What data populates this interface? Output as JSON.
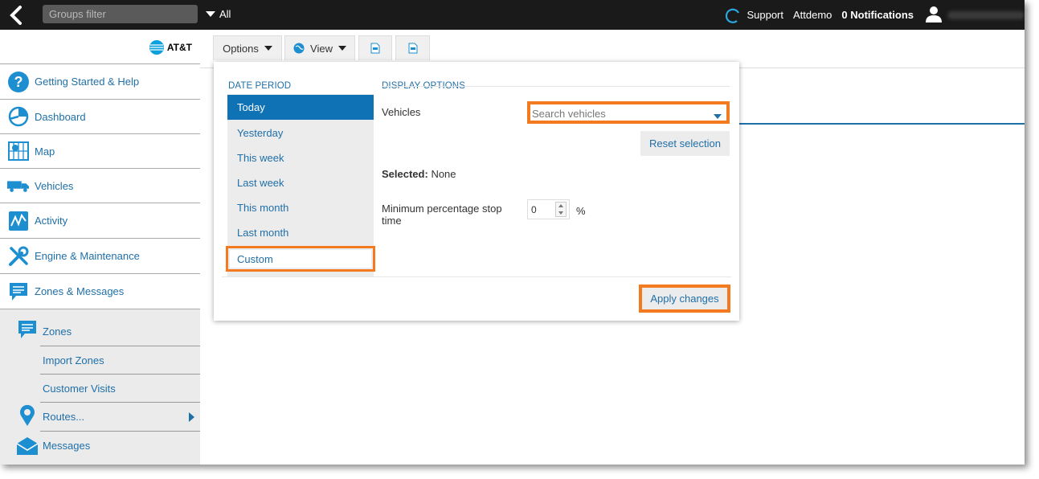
{
  "topbar": {
    "groups_filter_placeholder": "Groups filter",
    "all_label": "All",
    "support_label": "Support",
    "account_label": "Attdemo",
    "notifications_label": "0 Notifications"
  },
  "brand": {
    "logo_text": "AT&T"
  },
  "sidebar": {
    "items": [
      {
        "label": "Getting Started & Help",
        "icon": "help-icon"
      },
      {
        "label": "Dashboard",
        "icon": "pie-chart-icon"
      },
      {
        "label": "Map",
        "icon": "map-icon"
      },
      {
        "label": "Vehicles",
        "icon": "truck-icon"
      },
      {
        "label": "Activity",
        "icon": "activity-icon"
      },
      {
        "label": "Engine & Maintenance",
        "icon": "wrench-icon"
      },
      {
        "label": "Zones & Messages",
        "icon": "message-icon"
      }
    ],
    "sub_items": [
      {
        "label": "Zones",
        "icon": "zones-icon"
      },
      {
        "label": "Import Zones"
      },
      {
        "label": "Customer Visits"
      },
      {
        "label": "Routes...",
        "icon": "pin-icon"
      },
      {
        "label": "Messages",
        "icon": "envelope-icon"
      }
    ]
  },
  "toolbar": {
    "options_label": "Options",
    "view_label": "View"
  },
  "panel": {
    "date_period_title": "DATE PERIOD",
    "display_options_title": "DISPLAY OPTIONS",
    "periods": [
      "Today",
      "Yesterday",
      "This week",
      "Last week",
      "This month",
      "Last month",
      "Custom"
    ],
    "selected_period": "Today",
    "vehicles_label": "Vehicles",
    "search_placeholder": "Search vehicles",
    "reset_label": "Reset selection",
    "selected_label": "Selected:",
    "selected_value": "None",
    "min_stop_label_1": "Minimum percentage stop",
    "min_stop_label_2": "time",
    "min_stop_value": "0",
    "percent_sign": "%",
    "apply_label": "Apply changes"
  },
  "colors": {
    "accent": "#1f6fa8",
    "active_period": "#0e72b5",
    "highlight": "#f47a20",
    "topbar": "#1a1a1a"
  }
}
